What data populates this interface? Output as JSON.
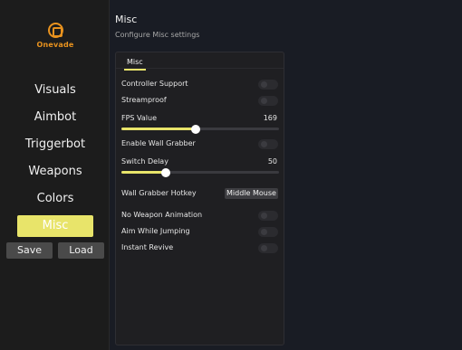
{
  "brand": {
    "logo_text": "Onevade",
    "color": "#e8921e"
  },
  "accent": "#e8e46a",
  "sidebar": {
    "items": [
      {
        "label": "Visuals"
      },
      {
        "label": "Aimbot"
      },
      {
        "label": "Triggerbot"
      },
      {
        "label": "Weapons"
      },
      {
        "label": "Colors"
      },
      {
        "label": "Misc",
        "active": true
      }
    ],
    "save_label": "Save",
    "load_label": "Load"
  },
  "header": {
    "title": "Misc",
    "subtitle": "Configure Misc settings"
  },
  "panel": {
    "tab": "Misc",
    "controller_support": {
      "label": "Controller Support",
      "enabled": false
    },
    "streamproof": {
      "label": "Streamproof",
      "enabled": false
    },
    "fps_value": {
      "label": "FPS Value",
      "value": "169",
      "fraction": 0.47
    },
    "wall_grabber": {
      "label": "Enable Wall Grabber",
      "enabled": false
    },
    "switch_delay": {
      "label": "Switch Delay",
      "value": "50",
      "fraction": 0.28
    },
    "wall_grabber_hotkey": {
      "label": "Wall Grabber Hotkey",
      "key": "Middle Mouse"
    },
    "no_weapon_animation": {
      "label": "No Weapon Animation",
      "enabled": false
    },
    "aim_while_jumping": {
      "label": "Aim While Jumping",
      "enabled": false
    },
    "instant_revive": {
      "label": "Instant Revive",
      "enabled": false
    }
  }
}
